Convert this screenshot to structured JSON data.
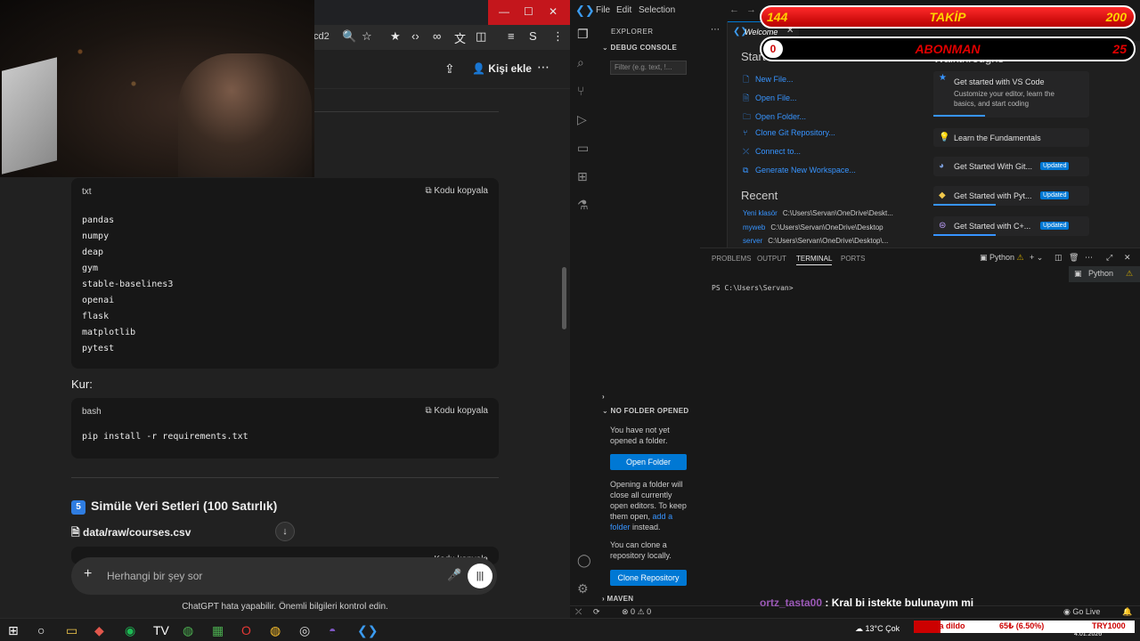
{
  "browser": {
    "url_tail": "cd2",
    "header": {
      "add_person": "Kişi ekle"
    },
    "requirements_block": {
      "lang": "txt",
      "copy": "Kodu kopyala",
      "lines": [
        "pandas",
        "numpy",
        "deap",
        "gym",
        "stable-baselines3",
        "openai",
        "flask",
        "matplotlib",
        "pytest"
      ]
    },
    "install_label": "Kur:",
    "install_block": {
      "lang": "bash",
      "copy": "Kodu kopyala",
      "command": "pip install -r requirements.txt"
    },
    "section": {
      "num": "5",
      "title": "Simüle Veri Setleri (100 Satırlık)"
    },
    "file": "data/raw/courses.csv",
    "partial_copy": "Kodu kopyala",
    "composer_placeholder": "Herhangi bir şey sor",
    "disclaimer": "ChatGPT hata yapabilir. Önemli bilgileri kontrol edin."
  },
  "vscode": {
    "menu": [
      "File",
      "Edit",
      "Selection"
    ],
    "sidebar": {
      "explorer": "EXPLORER",
      "debug_console": "DEBUG CONSOLE",
      "filter_placeholder": "Filter (e.g. text, !...",
      "no_folder": "NO FOLDER OPENED",
      "msg1": "You have not yet opened a folder.",
      "open_folder": "Open Folder",
      "msg2a": "Opening a folder will close all currently open editors. To keep them open,",
      "msg2_link": "add a folder",
      "msg2b": "instead.",
      "msg3": "You can clone a repository locally.",
      "clone_repo": "Clone Repository",
      "maven": "MAVEN"
    },
    "tab": {
      "label": "Welcome"
    },
    "welcome": {
      "start": "Start",
      "start_items": [
        "New File...",
        "Open File...",
        "Open Folder...",
        "Clone Git Repository...",
        "Connect to...",
        "Generate New Workspace..."
      ],
      "recent_title": "Recent",
      "recent": [
        {
          "name": "Yeni klasör",
          "path": "C:\\Users\\Servan\\OneDrive\\Deskt..."
        },
        {
          "name": "myweb",
          "path": "C:\\Users\\Servan\\OneDrive\\Desktop"
        },
        {
          "name": "server",
          "path": "C:\\Users\\Servan\\OneDrive\\Desktop\\..."
        }
      ],
      "walkthroughs_title": "Walkthroughs",
      "card1_title": "Get started with VS Code",
      "card1_desc": "Customize your editor, learn the basics, and start coding",
      "card2_title": "Learn the Fundamentals",
      "card3_title": "Get Started With Git...",
      "card4_title": "Get Started with Pyt...",
      "card5_title": "Get Started with C+...",
      "updated": "Updated"
    },
    "panel": {
      "tabs": [
        "PROBLEMS",
        "OUTPUT",
        "TERMINAL",
        "PORTS"
      ],
      "active_tab": "TERMINAL",
      "shell": "Python",
      "prompt": "PS C:\\Users\\Servan>"
    },
    "status": {
      "errors": "0",
      "warnings": "0",
      "golive": "Go Live"
    }
  },
  "overlay": {
    "follow_left": "144",
    "follow_label": "TAKİP",
    "follow_right": "200",
    "sub_left": "0",
    "sub_label": "ABONMAN",
    "sub_right": "25"
  },
  "chat": {
    "user": "ortz_tasta00",
    "message": "Kral bi istekte bulunayım mi"
  },
  "taskbar": {
    "weather": "13°C",
    "weather_text": "Çok",
    "ticker1": "ana dildo",
    "ticker2": "65₺ (6.50%)",
    "ticker3": "TRY1000",
    "date": "4.01.2026"
  },
  "colors": {
    "vscode_accent": "#0078d4",
    "link": "#3794ff",
    "overlay_red": "#e00000",
    "overlay_gold": "#ffd200"
  }
}
